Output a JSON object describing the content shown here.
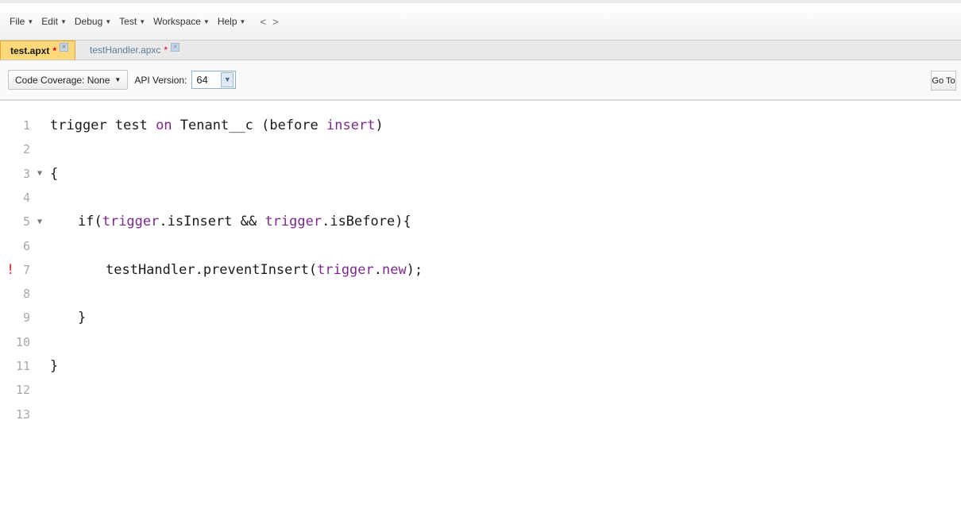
{
  "menu": {
    "items": [
      "File",
      "Edit",
      "Debug",
      "Test",
      "Workspace",
      "Help"
    ],
    "back": "<",
    "forward": ">"
  },
  "tabs": [
    {
      "label": "test.apxt",
      "modified": "*",
      "active": true
    },
    {
      "label": "testHandler.apxc",
      "modified": "*",
      "active": false
    }
  ],
  "toolbar": {
    "coverage_label": "Code Coverage: None",
    "api_label": "API Version:",
    "api_value": "64",
    "goto_label": "Go To"
  },
  "editor": {
    "lines": [
      {
        "num": "1",
        "indent": 0,
        "code": [
          [
            "t",
            "trigger test "
          ],
          [
            "k",
            "on"
          ],
          [
            "t",
            " Tenant__c (before "
          ],
          [
            "k",
            "insert"
          ],
          [
            "t",
            ")"
          ]
        ]
      },
      {
        "num": "2",
        "indent": 0,
        "code": []
      },
      {
        "num": "3",
        "indent": 0,
        "fold": true,
        "code": [
          [
            "t",
            "{"
          ]
        ]
      },
      {
        "num": "4",
        "indent": 0,
        "code": []
      },
      {
        "num": "5",
        "indent": 1,
        "fold": true,
        "code": [
          [
            "t",
            "if("
          ],
          [
            "k",
            "trigger"
          ],
          [
            "t",
            ".isInsert && "
          ],
          [
            "k",
            "trigger"
          ],
          [
            "t",
            ".isBefore){"
          ]
        ]
      },
      {
        "num": "6",
        "indent": 0,
        "code": []
      },
      {
        "num": "7",
        "indent": 2,
        "error": "!",
        "code": [
          [
            "t",
            "testHandler.preventInsert("
          ],
          [
            "k",
            "trigger"
          ],
          [
            "t",
            "."
          ],
          [
            "k",
            "new"
          ],
          [
            "t",
            ");"
          ]
        ]
      },
      {
        "num": "8",
        "indent": 0,
        "code": []
      },
      {
        "num": "9",
        "indent": 1,
        "code": [
          [
            "t",
            "}"
          ]
        ]
      },
      {
        "num": "10",
        "indent": 0,
        "code": []
      },
      {
        "num": "11",
        "indent": 0,
        "code": [
          [
            "t",
            "}"
          ]
        ]
      },
      {
        "num": "12",
        "indent": 0,
        "code": []
      },
      {
        "num": "13",
        "indent": 0,
        "code": []
      }
    ],
    "keyword_color": "#7b2a8a"
  }
}
